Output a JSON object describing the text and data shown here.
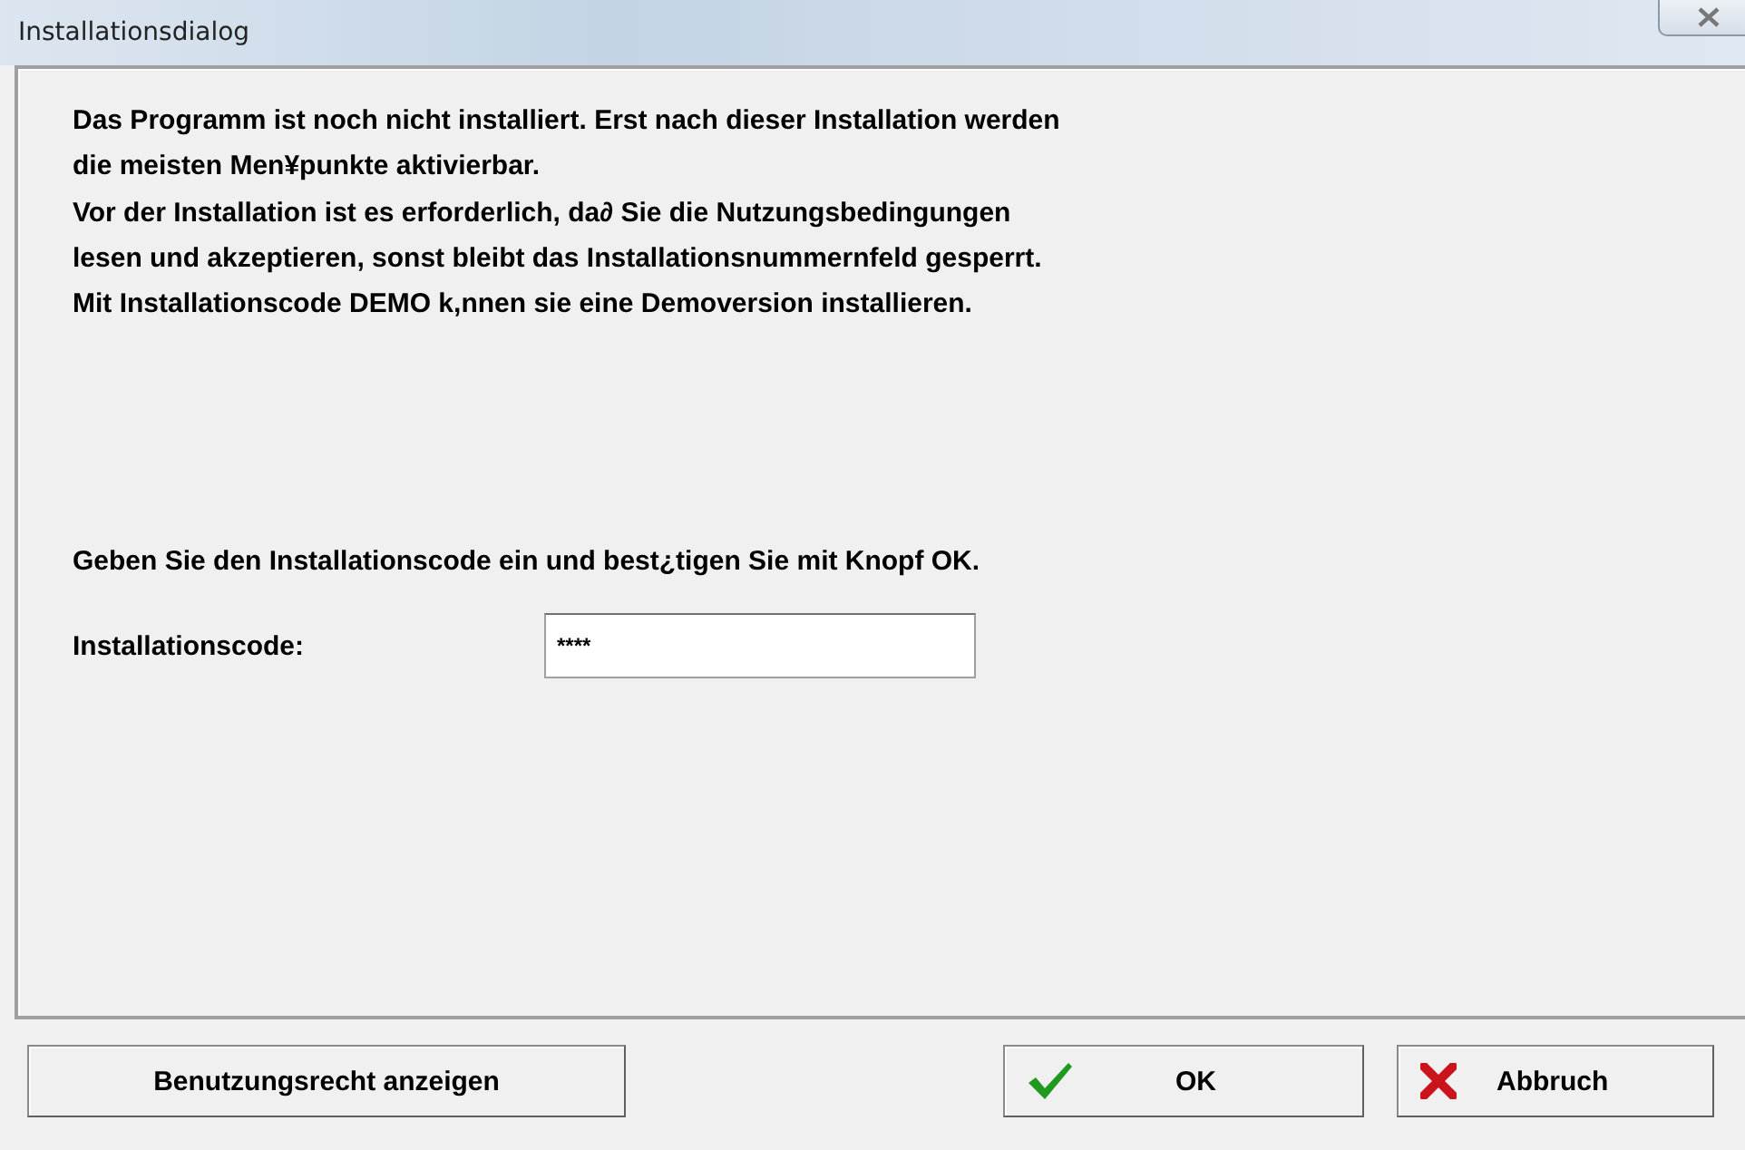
{
  "window": {
    "title": "Installationsdialog"
  },
  "message_lines": [
    "Das Programm ist noch nicht installiert. Erst nach dieser Installation werden",
    "die meisten Men¥punkte aktivierbar.",
    "Vor der Installation ist es erforderlich, da∂ Sie die Nutzungsbedingungen",
    "lesen und akzeptieren, sonst bleibt das Installationsnummernfeld gesperrt.",
    "Mit Installationscode DEMO k,nnen sie eine Demoversion installieren."
  ],
  "instruction": "Geben Sie den Installationscode ein und best¿tigen Sie mit Knopf OK.",
  "code_field": {
    "label": "Installationscode:",
    "value": "****"
  },
  "buttons": [
    {
      "kind": "plain",
      "label": "Benutzungsrecht anzeigen"
    },
    {
      "kind": "ok",
      "label": "OK"
    },
    {
      "kind": "cancel",
      "label": "Abbruch"
    }
  ]
}
